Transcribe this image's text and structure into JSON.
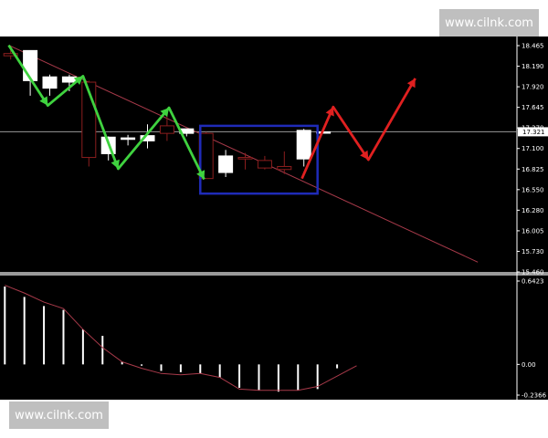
{
  "watermarks": {
    "top": "www.cilnk.com",
    "bottom": "www.cilnk.com"
  },
  "chart_data": [
    {
      "type": "candlestick",
      "price_axis": {
        "ticks": [
          "18.465",
          "18.190",
          "17.920",
          "17.645",
          "17.370",
          "17.100",
          "16.825",
          "16.550",
          "16.280",
          "16.005",
          "15.730",
          "15.460"
        ],
        "range": [
          15.46,
          18.465
        ]
      },
      "current_price": {
        "value": 17.321,
        "label": "17.321"
      },
      "bars": [
        {
          "o": 18.36,
          "h": 18.42,
          "l": 18.28,
          "c": 18.33
        },
        {
          "o": 18.0,
          "h": 18.4,
          "l": 17.8,
          "c": 18.4
        },
        {
          "o": 17.9,
          "h": 18.08,
          "l": 17.8,
          "c": 18.05
        },
        {
          "o": 17.98,
          "h": 18.08,
          "l": 17.86,
          "c": 18.05
        },
        {
          "o": 17.98,
          "h": 18.0,
          "l": 16.86,
          "c": 16.98
        },
        {
          "o": 17.03,
          "h": 17.26,
          "l": 16.94,
          "c": 17.25
        },
        {
          "o": 17.22,
          "h": 17.28,
          "l": 17.14,
          "c": 17.24
        },
        {
          "o": 17.2,
          "h": 17.42,
          "l": 17.1,
          "c": 17.27
        },
        {
          "o": 17.4,
          "h": 17.62,
          "l": 17.2,
          "c": 17.3
        },
        {
          "o": 17.3,
          "h": 17.36,
          "l": 17.26,
          "c": 17.36
        },
        {
          "o": 17.3,
          "h": 17.32,
          "l": 16.7,
          "c": 16.7
        },
        {
          "o": 16.78,
          "h": 17.08,
          "l": 16.72,
          "c": 17.0
        },
        {
          "o": 16.98,
          "h": 17.04,
          "l": 16.82,
          "c": 16.96
        },
        {
          "o": 16.94,
          "h": 17.0,
          "l": 16.82,
          "c": 16.84
        },
        {
          "o": 16.86,
          "h": 17.06,
          "l": 16.76,
          "c": 16.82
        },
        {
          "o": 16.96,
          "h": 17.36,
          "l": 16.86,
          "c": 17.34
        },
        {
          "o": 17.32,
          "h": 17.34,
          "l": 17.3,
          "c": 17.32
        }
      ],
      "trendline": [
        {
          "bar": 0.4,
          "price": 18.47
        },
        {
          "bar": 24.4,
          "price": 15.59
        }
      ],
      "green_path": [
        [
          0.4,
          18.47
        ],
        [
          2.4,
          17.67
        ],
        [
          4.2,
          18.06
        ],
        [
          6.0,
          16.83
        ],
        [
          8.6,
          17.64
        ],
        [
          10.4,
          16.69
        ]
      ],
      "red_path": [
        [
          15.4,
          16.7
        ],
        [
          17.0,
          17.65
        ],
        [
          18.8,
          16.95
        ],
        [
          21.2,
          18.03
        ]
      ],
      "box": {
        "bar_from": 10.2,
        "bar_to": 16.2,
        "price_from": 16.5,
        "price_to": 17.4
      },
      "macd_axis": {
        "ticks": [
          "0.6423",
          "0.00",
          "-0.2366"
        ],
        "range": [
          -0.2366,
          0.6423
        ]
      },
      "macd_bars": [
        0.6,
        0.52,
        0.45,
        0.42,
        0.27,
        0.22,
        0.02,
        -0.01,
        -0.05,
        -0.06,
        -0.07,
        -0.1,
        -0.18,
        -0.2,
        -0.21,
        -0.2,
        -0.19,
        -0.03
      ],
      "macd_signal_line": [
        0.61,
        0.55,
        0.48,
        0.43,
        0.27,
        0.13,
        0.02,
        -0.03,
        -0.07,
        -0.08,
        -0.07,
        -0.1,
        -0.19,
        -0.2,
        -0.2,
        -0.2,
        -0.17,
        -0.09,
        -0.01
      ]
    }
  ]
}
